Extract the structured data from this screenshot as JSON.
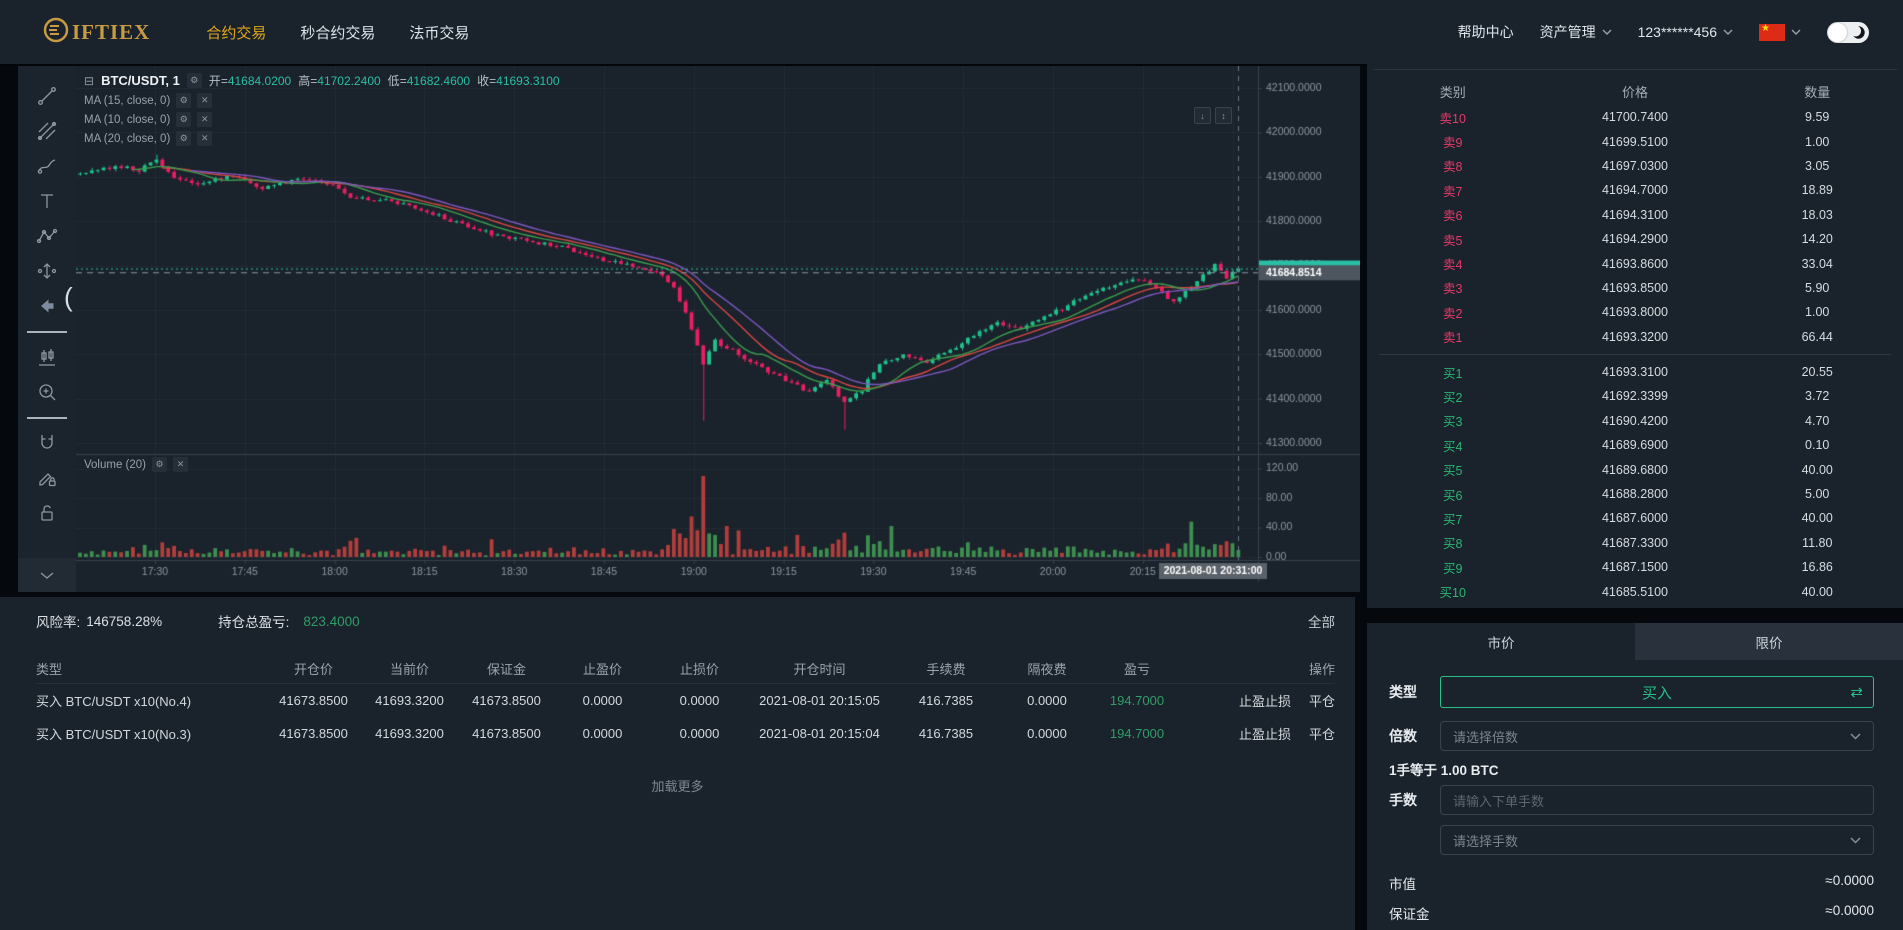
{
  "header": {
    "logo_text": "IFTIEX",
    "nav": [
      {
        "label": "合约交易",
        "active": true
      },
      {
        "label": "秒合约交易",
        "active": false
      },
      {
        "label": "法币交易",
        "active": false
      }
    ],
    "help": "帮助中心",
    "assets": "资产管理",
    "account": "123******456"
  },
  "chart": {
    "legend": {
      "collapse_icon": "⊟",
      "symbol": "BTC/USDT, 1",
      "open_label": "开",
      "open": "41684.0200",
      "high_label": "高",
      "high": "41702.2400",
      "low_label": "低",
      "low": "41682.4600",
      "close_label": "收",
      "close": "41693.3100",
      "ma1": "MA (15, close, 0)",
      "ma2": "MA (10, close, 0)",
      "ma3": "MA (20, close, 0)",
      "volume": "Volume (20)"
    }
  },
  "chart_data": {
    "type": "candlestick",
    "symbol": "BTC/USDT",
    "interval_minutes": 1,
    "ylim": [
      41250,
      42150
    ],
    "price_axis": [
      "42100.0000",
      "42000.0000",
      "41900.0000",
      "41800.0000",
      "41700.0000",
      "41600.0000",
      "41500.0000",
      "41400.0000",
      "41300.0000"
    ],
    "price_axis_values": [
      42100,
      42000,
      41900,
      41800,
      41700,
      41600,
      41500,
      41400,
      41300
    ],
    "volume_axis": [
      "120.00",
      "80.00",
      "40.00",
      "0.00"
    ],
    "volume_axis_values": [
      120,
      80,
      40,
      0
    ],
    "time_ticks": [
      "17:30",
      "17:45",
      "18:00",
      "18:15",
      "18:30",
      "18:45",
      "19:00",
      "19:15",
      "19:30",
      "19:45",
      "20:00",
      "20:15"
    ],
    "crosshair_time": "2021-08-01 20:31:00",
    "crosshair_price": "41684.8514",
    "last_price": 41693.31,
    "ma_periods": [
      15,
      10,
      20
    ],
    "anchors": [
      [
        0,
        41905
      ],
      [
        6,
        41925
      ],
      [
        10,
        41915
      ],
      [
        13,
        41938
      ],
      [
        16,
        41895
      ],
      [
        20,
        41885
      ],
      [
        26,
        41902
      ],
      [
        31,
        41875
      ],
      [
        36,
        41892
      ],
      [
        40,
        41896
      ],
      [
        44,
        41872
      ],
      [
        46,
        41856
      ],
      [
        52,
        41846
      ],
      [
        58,
        41826
      ],
      [
        64,
        41796
      ],
      [
        70,
        41772
      ],
      [
        76,
        41756
      ],
      [
        82,
        41742
      ],
      [
        88,
        41716
      ],
      [
        94,
        41700
      ],
      [
        98,
        41688
      ],
      [
        101,
        41650
      ],
      [
        104,
        41560
      ],
      [
        106,
        41480
      ],
      [
        108,
        41530
      ],
      [
        112,
        41500
      ],
      [
        116,
        41470
      ],
      [
        120,
        41440
      ],
      [
        124,
        41415
      ],
      [
        127,
        41445
      ],
      [
        130,
        41390
      ],
      [
        133,
        41420
      ],
      [
        136,
        41480
      ],
      [
        140,
        41500
      ],
      [
        144,
        41480
      ],
      [
        148,
        41510
      ],
      [
        152,
        41545
      ],
      [
        156,
        41570
      ],
      [
        160,
        41555
      ],
      [
        164,
        41585
      ],
      [
        168,
        41610
      ],
      [
        172,
        41640
      ],
      [
        176,
        41655
      ],
      [
        180,
        41670
      ],
      [
        184,
        41640
      ],
      [
        186,
        41615
      ],
      [
        190,
        41665
      ],
      [
        193,
        41700
      ],
      [
        195,
        41672
      ],
      [
        197,
        41693
      ]
    ],
    "wick_lows": {
      "106": 41350,
      "130": 41330
    },
    "wick_highs": {
      "13": 41950
    },
    "volume_spikes": {
      "46": 22,
      "47": 26,
      "70": 24,
      "101": 38,
      "104": 55,
      "106": 110,
      "108": 30,
      "110": 42,
      "112": 36,
      "122": 30,
      "130": 33,
      "138": 42,
      "151": 20,
      "189": 48,
      "191": 14
    }
  },
  "order_book": {
    "headers": [
      "类别",
      "价格",
      "数量"
    ],
    "sells": [
      [
        "卖10",
        "41700.7400",
        "9.59"
      ],
      [
        "卖9",
        "41699.5100",
        "1.00"
      ],
      [
        "卖8",
        "41697.0300",
        "3.05"
      ],
      [
        "卖7",
        "41694.7000",
        "18.89"
      ],
      [
        "卖6",
        "41694.3100",
        "18.03"
      ],
      [
        "卖5",
        "41694.2900",
        "14.20"
      ],
      [
        "卖4",
        "41693.8600",
        "33.04"
      ],
      [
        "卖3",
        "41693.8500",
        "5.90"
      ],
      [
        "卖2",
        "41693.8000",
        "1.00"
      ],
      [
        "卖1",
        "41693.3200",
        "66.44"
      ]
    ],
    "buys": [
      [
        "买1",
        "41693.3100",
        "20.55"
      ],
      [
        "买2",
        "41692.3399",
        "3.72"
      ],
      [
        "买3",
        "41690.4200",
        "4.70"
      ],
      [
        "买4",
        "41689.6900",
        "0.10"
      ],
      [
        "买5",
        "41689.6800",
        "40.00"
      ],
      [
        "买6",
        "41688.2800",
        "5.00"
      ],
      [
        "买7",
        "41687.6000",
        "40.00"
      ],
      [
        "买8",
        "41687.3300",
        "11.80"
      ],
      [
        "买9",
        "41687.1500",
        "16.86"
      ],
      [
        "买10",
        "41685.5100",
        "40.00"
      ]
    ]
  },
  "positions": {
    "risk_label": "风险率:",
    "risk_value": "146758.28%",
    "pnl_label": "持仓总盈亏:",
    "pnl_value": "823.4000",
    "filter_all": "全部",
    "headers": [
      "类型",
      "开仓价",
      "当前价",
      "保证金",
      "止盈价",
      "止损价",
      "开仓时间",
      "手续费",
      "隔夜费",
      "盈亏",
      "操作"
    ],
    "rows": [
      {
        "type": "买入 BTC/USDT x10(No.4)",
        "open": "41673.8500",
        "current": "41693.3200",
        "margin": "41673.8500",
        "tp": "0.0000",
        "sl": "0.0000",
        "time": "2021-08-01 20:15:05",
        "fee": "416.7385",
        "overnight": "0.0000",
        "pnl": "194.7000"
      },
      {
        "type": "买入 BTC/USDT x10(No.3)",
        "open": "41673.8500",
        "current": "41693.3200",
        "margin": "41673.8500",
        "tp": "0.0000",
        "sl": "0.0000",
        "time": "2021-08-01 20:15:04",
        "fee": "416.7385",
        "overnight": "0.0000",
        "pnl": "194.7000"
      }
    ],
    "action_tp_sl": "止盈止损",
    "action_close": "平仓",
    "load_more": "加载更多"
  },
  "trade_form": {
    "tab_market": "市价",
    "tab_limit": "限价",
    "type_label": "类型",
    "direction": "买入",
    "swap_icon": "⇄",
    "leverage_label": "倍数",
    "leverage_placeholder": "请选择倍数",
    "unit_text": "1手等于 1.00 BTC",
    "lots_label": "手数",
    "lots_placeholder": "请输入下单手数",
    "lots_select_placeholder": "请选择手数",
    "market_value_label": "市值",
    "market_value": "≈0.0000",
    "margin_label": "保证金",
    "margin_value": "≈0.0000"
  },
  "colors": {
    "up": "#1fc28d",
    "down": "#ea1f63",
    "teal": "#2abfa5",
    "sell_text": "#e23b69",
    "buy_text": "#2bb573",
    "gold": "#e2a71c",
    "pnl_green": "#2f9e68",
    "ma15": "#d84742",
    "ma10": "#3a9e4d",
    "ma20": "#7e57c2",
    "grid": "#232c36",
    "axis_line": "#39424c",
    "axis_text": "#8d97a2",
    "vol_up": "#3e8e50",
    "vol_down": "#b23e3c",
    "crosshair_box": "#5a6169",
    "price_box": "#4d565e"
  }
}
